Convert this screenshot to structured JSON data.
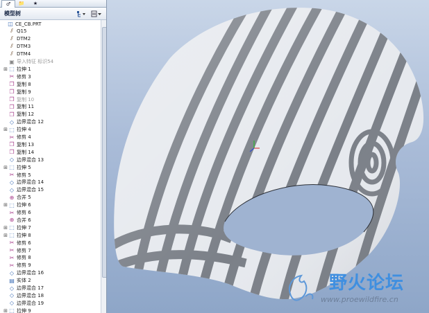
{
  "tabs": [
    {
      "label": "♂"
    },
    {
      "label": "📁"
    },
    {
      "label": "★"
    }
  ],
  "tree_header": {
    "title": "模型树",
    "settings_icon": "tree-settings-icon",
    "show_icon": "tree-show-icon"
  },
  "tree_items": [
    {
      "label": "CE_CB.PRT",
      "icon": "part-icon",
      "expandable": false,
      "dim": false
    },
    {
      "label": "Q15",
      "icon": "datum-plane-icon",
      "expandable": false,
      "dim": false
    },
    {
      "label": "DTM2",
      "icon": "datum-plane-icon",
      "expandable": false,
      "dim": false
    },
    {
      "label": "DTM3",
      "icon": "datum-plane-icon",
      "expandable": false,
      "dim": false
    },
    {
      "label": "DTM4",
      "icon": "datum-plane-icon",
      "expandable": false,
      "dim": false
    },
    {
      "label": "导入特征 标识54",
      "icon": "import-feature-icon",
      "expandable": false,
      "dim": true
    },
    {
      "label": "拉伸 1",
      "icon": "extrude-icon",
      "expandable": true,
      "dim": false
    },
    {
      "label": "修剪 3",
      "icon": "trim-icon",
      "expandable": false,
      "dim": false
    },
    {
      "label": "复制 8",
      "icon": "copy-icon",
      "expandable": false,
      "dim": false
    },
    {
      "label": "复制 9",
      "icon": "copy-icon",
      "expandable": false,
      "dim": false
    },
    {
      "label": "复制 10",
      "icon": "copy-icon",
      "expandable": false,
      "dim": true
    },
    {
      "label": "复制 11",
      "icon": "copy-icon",
      "expandable": false,
      "dim": false
    },
    {
      "label": "复制 12",
      "icon": "copy-icon",
      "expandable": false,
      "dim": false
    },
    {
      "label": "边界混合 12",
      "icon": "boundary-blend-icon",
      "expandable": false,
      "dim": false
    },
    {
      "label": "拉伸 4",
      "icon": "extrude-icon",
      "expandable": true,
      "dim": false
    },
    {
      "label": "修剪 4",
      "icon": "trim-icon",
      "expandable": false,
      "dim": false
    },
    {
      "label": "复制 13",
      "icon": "copy-icon",
      "expandable": false,
      "dim": false
    },
    {
      "label": "复制 14",
      "icon": "copy-icon",
      "expandable": false,
      "dim": false
    },
    {
      "label": "边界混合 13",
      "icon": "boundary-blend-icon",
      "expandable": false,
      "dim": false
    },
    {
      "label": "拉伸 5",
      "icon": "extrude-icon",
      "expandable": true,
      "dim": false
    },
    {
      "label": "修剪 5",
      "icon": "trim-icon",
      "expandable": false,
      "dim": false
    },
    {
      "label": "边界混合 14",
      "icon": "boundary-blend-icon",
      "expandable": false,
      "dim": false
    },
    {
      "label": "边界混合 15",
      "icon": "boundary-blend-icon",
      "expandable": false,
      "dim": false
    },
    {
      "label": "合并 5",
      "icon": "merge-icon",
      "expandable": false,
      "dim": false
    },
    {
      "label": "拉伸 6",
      "icon": "extrude-icon",
      "expandable": true,
      "dim": false
    },
    {
      "label": "修剪 6",
      "icon": "trim-icon",
      "expandable": false,
      "dim": false
    },
    {
      "label": "合并 6",
      "icon": "merge-icon",
      "expandable": false,
      "dim": false
    },
    {
      "label": "拉伸 7",
      "icon": "extrude-icon",
      "expandable": true,
      "dim": false
    },
    {
      "label": "拉伸 8",
      "icon": "extrude-icon",
      "expandable": true,
      "dim": false
    },
    {
      "label": "修剪 6",
      "icon": "trim-icon",
      "expandable": false,
      "dim": false
    },
    {
      "label": "修剪 7",
      "icon": "trim-icon",
      "expandable": false,
      "dim": false
    },
    {
      "label": "修剪 8",
      "icon": "trim-icon",
      "expandable": false,
      "dim": false
    },
    {
      "label": "修剪 9",
      "icon": "trim-icon",
      "expandable": false,
      "dim": false
    },
    {
      "label": "边界混合 16",
      "icon": "boundary-blend-icon",
      "expandable": false,
      "dim": false
    },
    {
      "label": "实体 2",
      "icon": "solid-icon",
      "expandable": false,
      "dim": false
    },
    {
      "label": "边界混合 17",
      "icon": "boundary-blend-icon",
      "expandable": false,
      "dim": false
    },
    {
      "label": "边界混合 18",
      "icon": "boundary-blend-icon",
      "expandable": false,
      "dim": false
    },
    {
      "label": "边界混合 19",
      "icon": "boundary-blend-icon",
      "expandable": false,
      "dim": false
    },
    {
      "label": "拉伸 9",
      "icon": "extrude-icon",
      "expandable": true,
      "dim": false
    }
  ],
  "viewport": {
    "background_top": "#c9d6e8",
    "background_bottom": "#8ea6c8",
    "surface_stripe_light": "#e6e9ee",
    "surface_stripe_dark": "#7b8088"
  },
  "watermark": {
    "title": "野火论坛",
    "url": "www.proewildfire.cn",
    "color": "#3f8fe0"
  }
}
